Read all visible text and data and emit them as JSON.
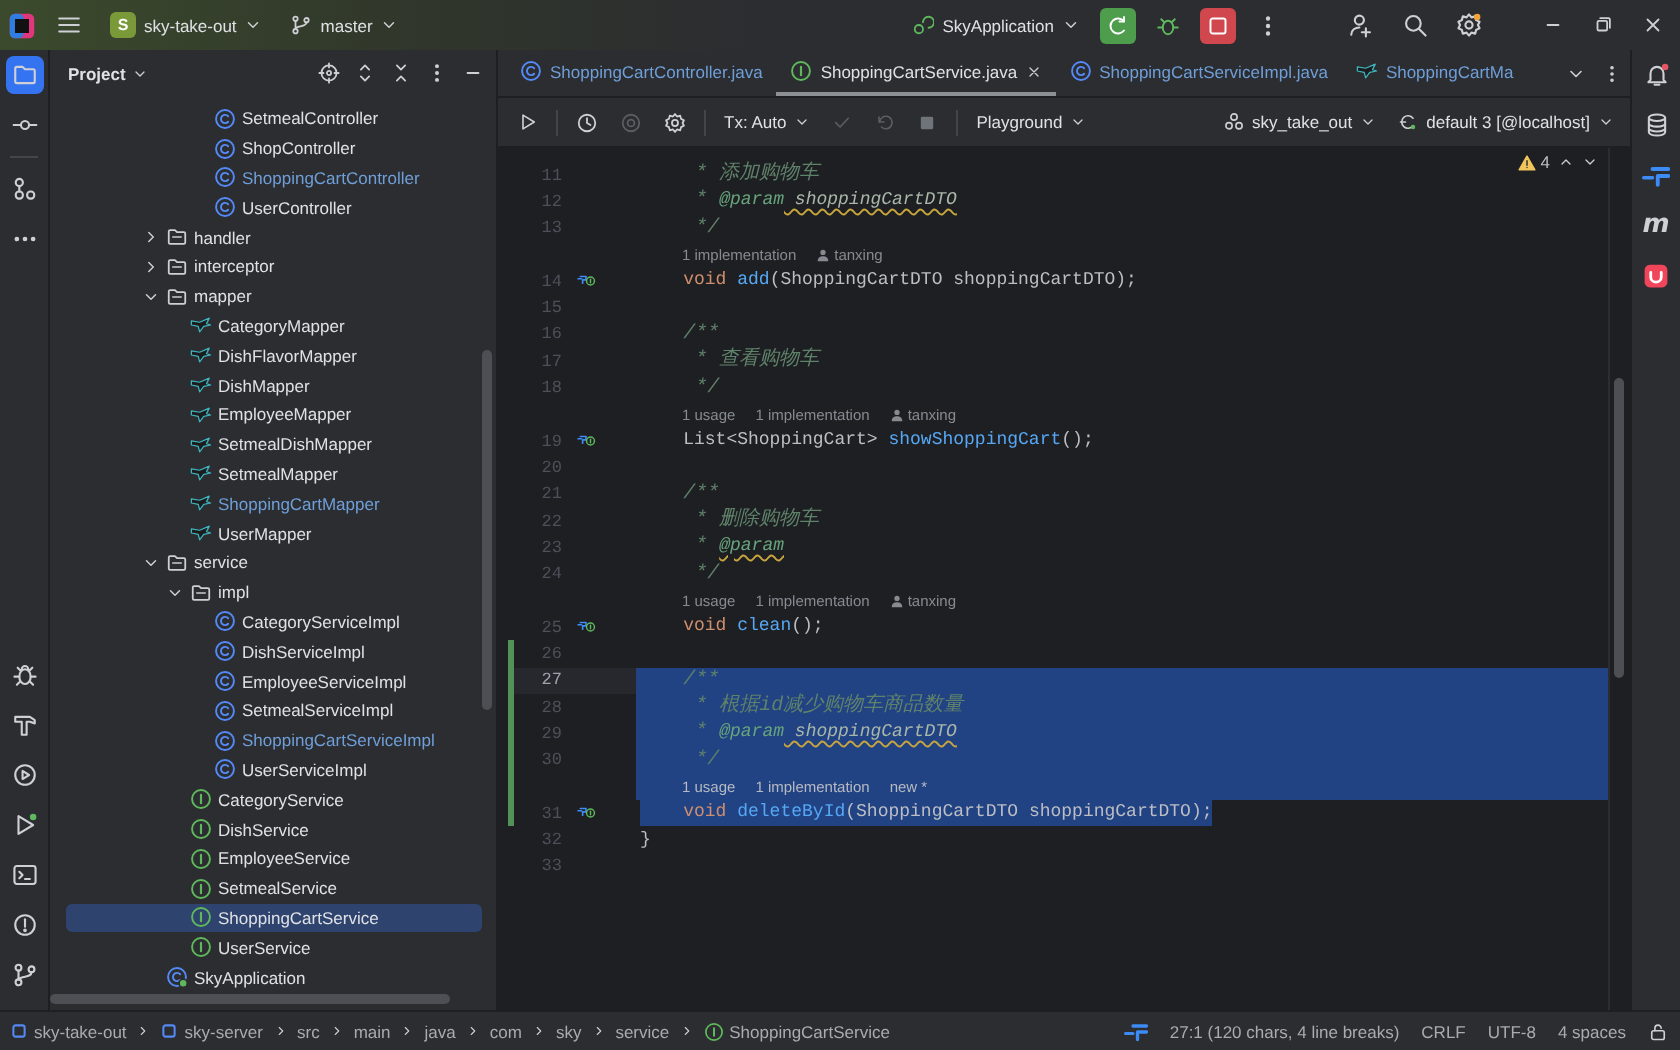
{
  "title_bar": {
    "project_badge": "S",
    "project": "sky-take-out",
    "branch": "master",
    "run_config": "SkyApplication"
  },
  "project_panel": {
    "title": "Project",
    "tree": [
      {
        "children": [
          {
            "children": [
              {
                "label": "SetmealController",
                "kind": "class",
                "modified": false,
                "selected": false
              },
              {
                "label": "ShopController",
                "kind": "class",
                "modified": false,
                "selected": false
              },
              {
                "label": "ShoppingCartController",
                "kind": "class",
                "modified": true,
                "selected": false
              },
              {
                "label": "UserController",
                "kind": "class",
                "modified": false,
                "selected": false
              }
            ]
          }
        ]
      },
      {
        "label": "handler",
        "kind": "folder",
        "expanded": false,
        "modified": false,
        "selected": false
      },
      {
        "label": "interceptor",
        "kind": "folder",
        "expanded": false,
        "modified": false,
        "selected": false
      },
      {
        "label": "mapper",
        "kind": "folder",
        "expanded": true,
        "modified": false,
        "selected": false,
        "children": [
          {
            "label": "CategoryMapper",
            "kind": "mapper",
            "modified": false,
            "selected": false
          },
          {
            "label": "DishFlavorMapper",
            "kind": "mapper",
            "modified": false,
            "selected": false
          },
          {
            "label": "DishMapper",
            "kind": "mapper",
            "modified": false,
            "selected": false
          },
          {
            "label": "EmployeeMapper",
            "kind": "mapper",
            "modified": false,
            "selected": false
          },
          {
            "label": "SetmealDishMapper",
            "kind": "mapper",
            "modified": false,
            "selected": false
          },
          {
            "label": "SetmealMapper",
            "kind": "mapper",
            "modified": false,
            "selected": false
          },
          {
            "label": "ShoppingCartMapper",
            "kind": "mapper",
            "modified": true,
            "selected": false
          },
          {
            "label": "UserMapper",
            "kind": "mapper",
            "modified": false,
            "selected": false
          }
        ]
      },
      {
        "label": "service",
        "kind": "folder",
        "expanded": true,
        "modified": false,
        "selected": false,
        "children": [
          {
            "label": "impl",
            "kind": "folder",
            "expanded": true,
            "modified": false,
            "selected": false,
            "children": [
              {
                "label": "CategoryServiceImpl",
                "kind": "class",
                "modified": false,
                "selected": false
              },
              {
                "label": "DishServiceImpl",
                "kind": "class",
                "modified": false,
                "selected": false
              },
              {
                "label": "EmployeeServiceImpl",
                "kind": "class",
                "modified": false,
                "selected": false
              },
              {
                "label": "SetmealServiceImpl",
                "kind": "class",
                "modified": false,
                "selected": false
              },
              {
                "label": "ShoppingCartServiceImpl",
                "kind": "class",
                "modified": true,
                "selected": false
              },
              {
                "label": "UserServiceImpl",
                "kind": "class",
                "modified": false,
                "selected": false
              }
            ]
          },
          {
            "label": "CategoryService",
            "kind": "interface",
            "modified": false,
            "selected": false
          },
          {
            "label": "DishService",
            "kind": "interface",
            "modified": false,
            "selected": false
          },
          {
            "label": "EmployeeService",
            "kind": "interface",
            "modified": false,
            "selected": false
          },
          {
            "label": "SetmealService",
            "kind": "interface",
            "modified": false,
            "selected": false
          },
          {
            "label": "ShoppingCartService",
            "kind": "interface",
            "modified": false,
            "selected": true
          },
          {
            "label": "UserService",
            "kind": "interface",
            "modified": false,
            "selected": false
          }
        ]
      },
      {
        "label": "SkyApplication",
        "kind": "application",
        "modified": false,
        "selected": false
      }
    ]
  },
  "editor": {
    "tabs": [
      {
        "label": "ShoppingCartController.java",
        "kind": "class",
        "modified": true,
        "selected": false
      },
      {
        "label": "ShoppingCartService.java",
        "kind": "interface",
        "modified": false,
        "selected": true
      },
      {
        "label": "ShoppingCartServiceImpl.java",
        "kind": "class",
        "modified": true,
        "selected": false
      },
      {
        "label": "ShoppingCartMa",
        "kind": "mapper",
        "modified": true,
        "selected": false
      }
    ],
    "toolbar": {
      "transaction": "Tx: Auto",
      "playground": "Playground",
      "schema": "sky_take_out",
      "datasource": "default 3 [@localhost]"
    },
    "warnings": "4",
    "lines": [
      {
        "kind": "code",
        "number": "11",
        "indented": true,
        "segments": [
          {
            "kind": "comment",
            "text": " * 添加购物车"
          }
        ],
        "current": false,
        "implemented": false,
        "selected": false,
        "changed": false
      },
      {
        "kind": "code",
        "number": "12",
        "indented": true,
        "segments": [
          {
            "kind": "comment",
            "text": " * "
          },
          {
            "kind": "doc_tag",
            "text": "@param",
            "warning": false
          },
          {
            "kind": "doc_param",
            "text": " shoppingCartDTO",
            "warning": true
          }
        ],
        "current": false,
        "implemented": false,
        "selected": false,
        "changed": false
      },
      {
        "kind": "code",
        "number": "13",
        "indented": true,
        "segments": [
          {
            "kind": "comment",
            "text": " */"
          }
        ],
        "current": false,
        "implemented": false,
        "selected": false,
        "changed": false
      },
      {
        "kind": "hint",
        "hints": [
          {
            "kind": "text",
            "text": "1 implementation"
          },
          {
            "kind": "author",
            "text": "tanxing"
          }
        ],
        "selected": false,
        "changed": false
      },
      {
        "kind": "code",
        "number": "14",
        "indented": true,
        "segments": [
          {
            "kind": "keyword",
            "text": "void "
          },
          {
            "kind": "method",
            "text": "add"
          },
          {
            "kind": "plain",
            "text": "(ShoppingCartDTO shoppingCartDTO);"
          }
        ],
        "current": false,
        "implemented": true,
        "selected": false,
        "changed": false
      },
      {
        "kind": "code",
        "number": "15",
        "indented": false,
        "current": false,
        "implemented": false,
        "selected": false,
        "changed": false
      },
      {
        "kind": "code",
        "number": "16",
        "indented": true,
        "segments": [
          {
            "kind": "comment",
            "text": "/**"
          }
        ],
        "current": false,
        "implemented": false,
        "selected": false,
        "changed": false
      },
      {
        "kind": "code",
        "number": "17",
        "indented": true,
        "segments": [
          {
            "kind": "comment",
            "text": " * 查看购物车"
          }
        ],
        "current": false,
        "implemented": false,
        "selected": false,
        "changed": false
      },
      {
        "kind": "code",
        "number": "18",
        "indented": true,
        "segments": [
          {
            "kind": "comment",
            "text": " */"
          }
        ],
        "current": false,
        "implemented": false,
        "selected": false,
        "changed": false
      },
      {
        "kind": "hint",
        "hints": [
          {
            "kind": "text",
            "text": "1 usage"
          },
          {
            "kind": "text",
            "text": "1 implementation"
          },
          {
            "kind": "author",
            "text": "tanxing"
          }
        ],
        "selected": false,
        "changed": false
      },
      {
        "kind": "code",
        "number": "19",
        "indented": true,
        "segments": [
          {
            "kind": "plain",
            "text": "List<ShoppingCart> "
          },
          {
            "kind": "method",
            "text": "showShoppingCart"
          },
          {
            "kind": "plain",
            "text": "();"
          }
        ],
        "current": false,
        "implemented": true,
        "selected": false,
        "changed": false
      },
      {
        "kind": "code",
        "number": "20",
        "indented": false,
        "current": false,
        "implemented": false,
        "selected": false,
        "changed": false
      },
      {
        "kind": "code",
        "number": "21",
        "indented": true,
        "segments": [
          {
            "kind": "comment",
            "text": "/**"
          }
        ],
        "current": false,
        "implemented": false,
        "selected": false,
        "changed": false
      },
      {
        "kind": "code",
        "number": "22",
        "indented": true,
        "segments": [
          {
            "kind": "comment",
            "text": " * 删除购物车"
          }
        ],
        "current": false,
        "implemented": false,
        "selected": false,
        "changed": false
      },
      {
        "kind": "code",
        "number": "23",
        "indented": true,
        "segments": [
          {
            "kind": "comment",
            "text": " * "
          },
          {
            "kind": "doc_tag",
            "text": "@param",
            "warning": true
          }
        ],
        "current": false,
        "implemented": false,
        "selected": false,
        "changed": false
      },
      {
        "kind": "code",
        "number": "24",
        "indented": true,
        "segments": [
          {
            "kind": "comment",
            "text": " */"
          }
        ],
        "current": false,
        "implemented": false,
        "selected": false,
        "changed": false
      },
      {
        "kind": "hint",
        "hints": [
          {
            "kind": "text",
            "text": "1 usage"
          },
          {
            "kind": "text",
            "text": "1 implementation"
          },
          {
            "kind": "author",
            "text": "tanxing"
          }
        ],
        "selected": false,
        "changed": false
      },
      {
        "kind": "code",
        "number": "25",
        "indented": true,
        "segments": [
          {
            "kind": "keyword",
            "text": "void "
          },
          {
            "kind": "method",
            "text": "clean"
          },
          {
            "kind": "plain",
            "text": "();"
          }
        ],
        "current": false,
        "implemented": true,
        "selected": false,
        "changed": false
      },
      {
        "kind": "code",
        "number": "26",
        "indented": false,
        "current": false,
        "implemented": false,
        "selected": false,
        "changed": true
      },
      {
        "kind": "code",
        "number": "27",
        "indented": true,
        "segments": [
          {
            "kind": "comment",
            "text": "/**"
          }
        ],
        "current": true,
        "implemented": false,
        "selected": true,
        "changed": true
      },
      {
        "kind": "code",
        "number": "28",
        "indented": true,
        "segments": [
          {
            "kind": "comment",
            "text": " * 根据id减少购物车商品数量"
          }
        ],
        "current": false,
        "implemented": false,
        "selected": true,
        "changed": true
      },
      {
        "kind": "code",
        "number": "29",
        "indented": true,
        "segments": [
          {
            "kind": "comment",
            "text": " * "
          },
          {
            "kind": "doc_tag",
            "text": "@param",
            "warning": false
          },
          {
            "kind": "doc_param",
            "text": " shoppingCartDTO",
            "warning": true
          }
        ],
        "current": false,
        "implemented": false,
        "selected": true,
        "changed": true
      },
      {
        "kind": "code",
        "number": "30",
        "indented": true,
        "segments": [
          {
            "kind": "comment",
            "text": " */"
          }
        ],
        "current": false,
        "implemented": false,
        "selected": true,
        "changed": true
      },
      {
        "kind": "hint",
        "hints": [
          {
            "kind": "text",
            "text": "1 usage"
          },
          {
            "kind": "text",
            "text": "1 implementation"
          },
          {
            "kind": "text",
            "text": "new *"
          }
        ],
        "selected": true,
        "changed": true
      },
      {
        "kind": "code",
        "number": "31",
        "indented": true,
        "segments": [
          {
            "kind": "keyword",
            "text": "void "
          },
          {
            "kind": "method",
            "text": "deleteById"
          },
          {
            "kind": "plain",
            "text": "(ShoppingCartDTO shoppingCartDTO);"
          }
        ],
        "current": false,
        "implemented": true,
        "selected": true,
        "changed": true
      },
      {
        "kind": "code",
        "number": "32",
        "indented": false,
        "segments": [
          {
            "kind": "plain",
            "text": "}"
          }
        ],
        "current": false,
        "implemented": false,
        "selected": false,
        "changed": false
      },
      {
        "kind": "code",
        "number": "33",
        "indented": false,
        "current": false,
        "implemented": false,
        "selected": false,
        "changed": false
      }
    ]
  },
  "right_toolbar": {
    "m_label": "m"
  },
  "status_bar": {
    "breadcrumbs": [
      {
        "label": "sky-take-out",
        "kind": "module"
      },
      {
        "label": "sky-server",
        "kind": "module"
      },
      {
        "label": "src",
        "kind": "folder"
      },
      {
        "label": "main",
        "kind": "folder"
      },
      {
        "label": "java",
        "kind": "folder"
      },
      {
        "label": "com",
        "kind": "folder"
      },
      {
        "label": "sky",
        "kind": "folder"
      },
      {
        "label": "service",
        "kind": "folder"
      },
      {
        "label": "ShoppingCartService",
        "kind": "interface"
      }
    ],
    "position": "27:1 (120 chars, 4 line breaks)",
    "line_separator": "CRLF",
    "encoding": "UTF-8",
    "indent": "4 spaces"
  }
}
